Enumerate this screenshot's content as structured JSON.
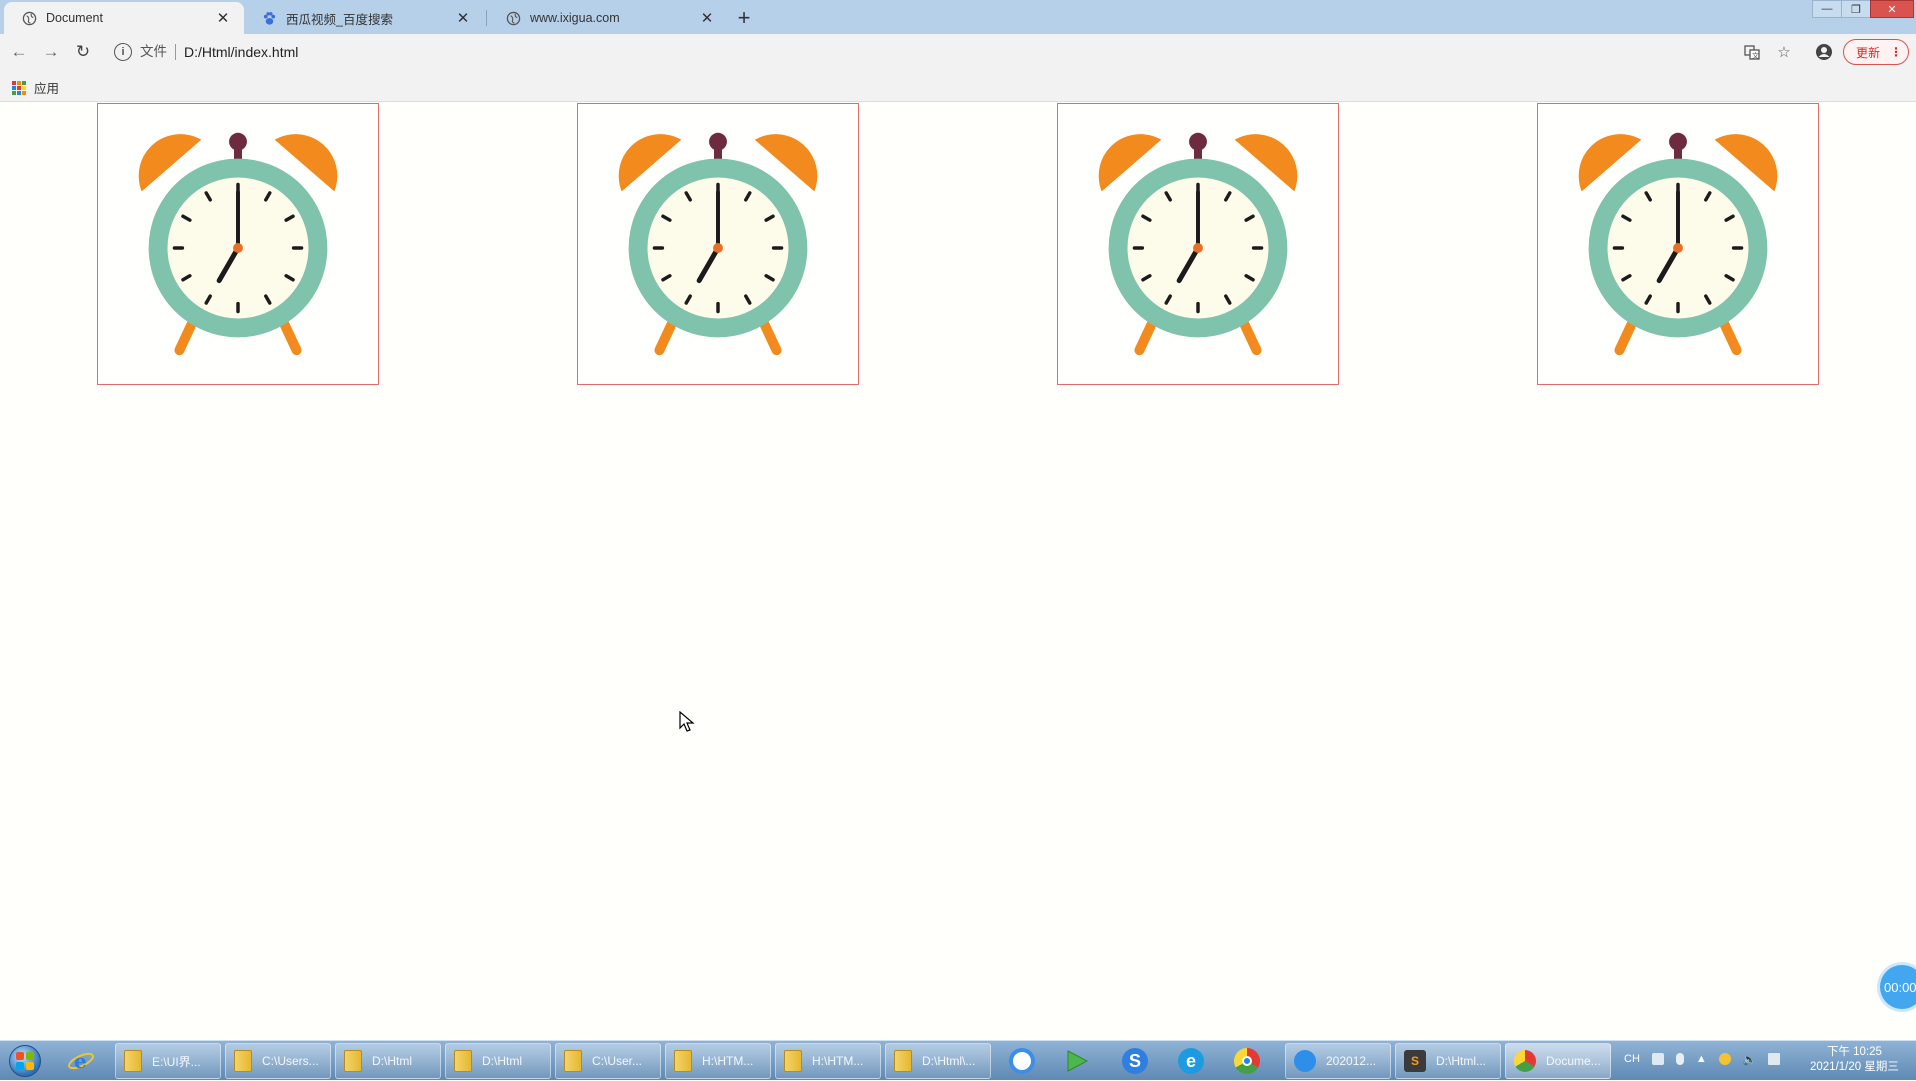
{
  "browser": {
    "tabs": [
      {
        "title": "Document",
        "active": true
      },
      {
        "title": "西瓜视频_百度搜索",
        "active": false
      },
      {
        "title": "www.ixigua.com",
        "active": false
      }
    ],
    "address": {
      "scheme_label": "文件",
      "url": "D:/Html/index.html"
    },
    "update_label": "更新",
    "bookmarks": {
      "apps_label": "应用"
    }
  },
  "page": {
    "clocks": [
      {
        "hour": 7,
        "minute": 0
      },
      {
        "hour": 7,
        "minute": 0
      },
      {
        "hour": 7,
        "minute": 0
      },
      {
        "hour": 7,
        "minute": 0
      }
    ],
    "colors": {
      "frame_border": "#e46a6a",
      "bell": "#f28a1e",
      "clock_ring": "#7fc3ad",
      "clock_face": "#fdfbea",
      "hands": "#1b1b1b",
      "feet": "#f28a1e"
    },
    "recording_timer": "00:00"
  },
  "taskbar": {
    "items": [
      {
        "label": "E:\\UI界..."
      },
      {
        "label": "C:\\Users..."
      },
      {
        "label": "D:\\Html"
      },
      {
        "label": "D:\\Html"
      },
      {
        "label": "C:\\User..."
      },
      {
        "label": "H:\\HTM..."
      },
      {
        "label": "H:\\HTM..."
      },
      {
        "label": "D:\\Html\\..."
      },
      {
        "label": "202012..."
      },
      {
        "label": "D:\\Html..."
      },
      {
        "label": "Docume..."
      }
    ],
    "time": "下午 10:25",
    "date": "2021/1/20 星期三",
    "ime": "CH"
  }
}
